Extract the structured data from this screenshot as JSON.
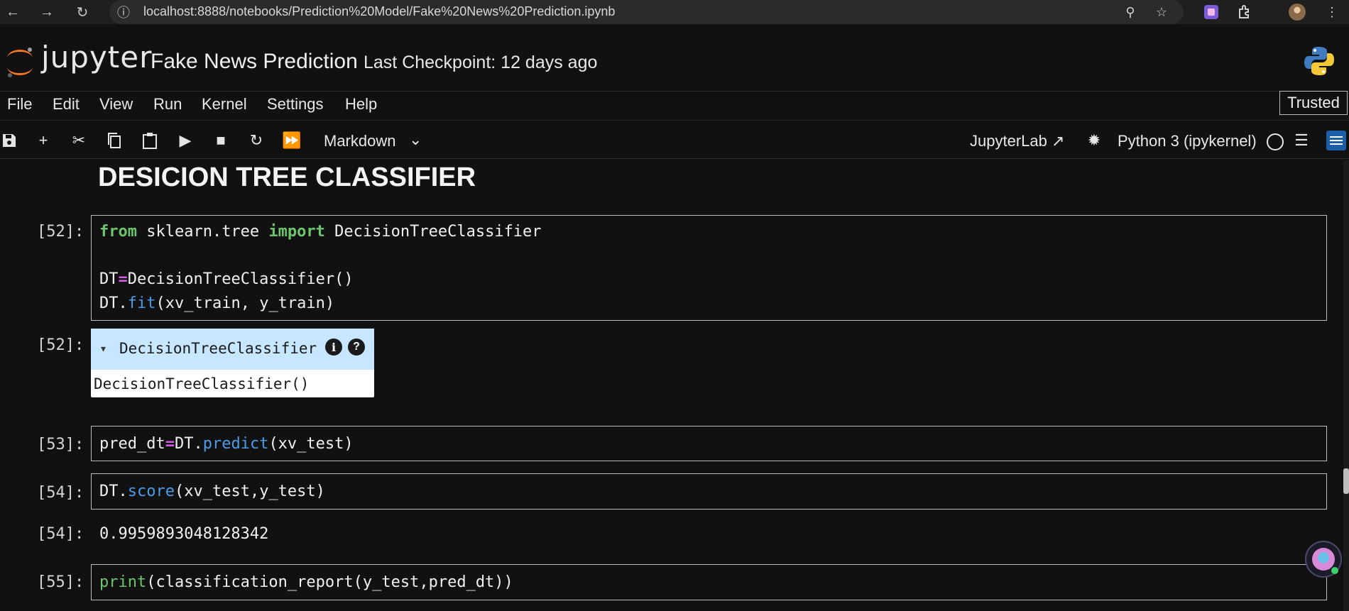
{
  "browser": {
    "url": "localhost:8888/notebooks/Prediction%20Model/Fake%20News%20Prediction.ipynb"
  },
  "header": {
    "logo_text": "jupyter",
    "notebook_title": "Fake News Prediction",
    "checkpoint": "Last Checkpoint: 12 days ago"
  },
  "menu": {
    "items": [
      "File",
      "Edit",
      "View",
      "Run",
      "Kernel",
      "Settings",
      "Help"
    ],
    "trusted": "Trusted"
  },
  "toolbar": {
    "cell_type": "Markdown",
    "jupyterlab_link": "JupyterLab",
    "kernel": "Python 3 (ipykernel)"
  },
  "notebook": {
    "heading": "DESICION TREE CLASSIFIER",
    "cells": [
      {
        "prompt": "[52]:",
        "lines": [
          "from sklearn.tree import DecisionTreeClassifier",
          "",
          "DT=DecisionTreeClassifier()",
          "DT.fit(xv_train, y_train)"
        ],
        "output_prompt": "[52]:",
        "estimator_name": "DecisionTreeClassifier",
        "estimator_repr": "DecisionTreeClassifier()"
      },
      {
        "prompt": "[53]:",
        "lines": [
          "pred_dt=DT.predict(xv_test)"
        ]
      },
      {
        "prompt": "[54]:",
        "lines": [
          "DT.score(xv_test,y_test)"
        ],
        "output_prompt": "[54]:",
        "output": "0.9959893048128342"
      },
      {
        "prompt": "[55]:",
        "lines": [
          "print(classification_report(y_test,pred_dt))"
        ]
      }
    ]
  }
}
